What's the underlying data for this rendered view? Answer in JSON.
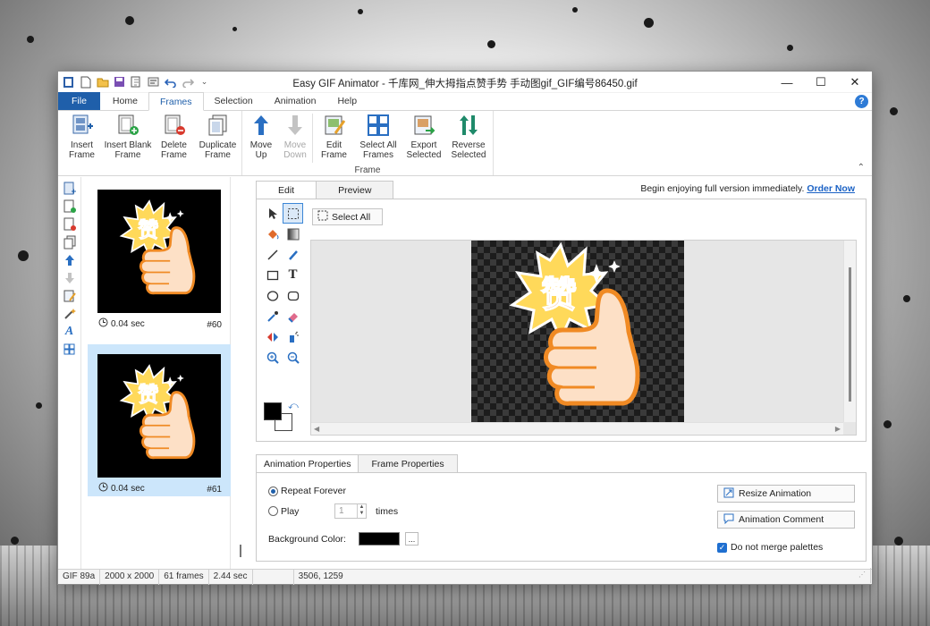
{
  "window": {
    "title": "Easy GIF Animator - 千库网_伸大拇指点赞手势 手动图gif_GIF编号86450.gif",
    "minimize": "—",
    "maximize": "☐",
    "close": "✕",
    "qat_dropdown": "⌄"
  },
  "ribbon": {
    "tabs": [
      "File",
      "Home",
      "Frames",
      "Selection",
      "Animation",
      "Help"
    ],
    "active_tab": "Frames",
    "help_icon": "?",
    "groups": [
      {
        "label": "",
        "buttons": [
          {
            "label": "Insert Frame",
            "line1": "Insert",
            "line2": "Frame",
            "icon": "insert-frame-icon"
          },
          {
            "label": "Insert Blank Frame",
            "line1": "Insert Blank",
            "line2": "Frame",
            "icon": "insert-blank-frame-icon"
          },
          {
            "label": "Delete Frame",
            "line1": "Delete",
            "line2": "Frame",
            "icon": "delete-frame-icon"
          },
          {
            "label": "Duplicate Frame",
            "line1": "Duplicate",
            "line2": "Frame",
            "icon": "duplicate-frame-icon"
          }
        ]
      },
      {
        "label": "Frame",
        "buttons": [
          {
            "label": "Move Up",
            "line1": "Move",
            "line2": "Up",
            "icon": "arrow-up-icon"
          },
          {
            "label": "Move Down",
            "line1": "Move",
            "line2": "Down",
            "icon": "arrow-down-icon",
            "disabled": true
          },
          {
            "label": "Edit Frame",
            "line1": "Edit",
            "line2": "Frame",
            "icon": "edit-frame-icon"
          },
          {
            "label": "Select All Frames",
            "line1": "Select All",
            "line2": "Frames",
            "icon": "select-all-frames-icon"
          },
          {
            "label": "Export Selected",
            "line1": "Export",
            "line2": "Selected",
            "icon": "export-selected-icon"
          },
          {
            "label": "Reverse Selected",
            "line1": "Reverse",
            "line2": "Selected",
            "icon": "reverse-selected-icon"
          }
        ]
      }
    ],
    "collapse": "⌃"
  },
  "frames": [
    {
      "time": "0.04 sec",
      "number": "#60",
      "selected": false
    },
    {
      "time": "0.04 sec",
      "number": "#61",
      "selected": true
    }
  ],
  "frame_graphic_text": "赞",
  "editor": {
    "tabs": [
      "Edit",
      "Preview"
    ],
    "active_tab": "Edit",
    "promo_text": "Begin enjoying full version immediately.",
    "promo_link": "Order Now",
    "select_all_button": "Select All",
    "scroll_left": "◀",
    "scroll_right": "▶"
  },
  "properties": {
    "tabs": [
      "Animation Properties",
      "Frame Properties"
    ],
    "active_tab": "Animation Properties",
    "repeat_forever": "Repeat Forever",
    "play": "Play",
    "play_times_value": "1",
    "times": "times",
    "background_color_label": "Background Color:",
    "background_color": "#000000",
    "dots_button": "...",
    "resize_button": "Resize Animation",
    "comment_button": "Animation Comment",
    "merge_checkbox": "Do not merge palettes",
    "merge_checked": true
  },
  "statusbar": {
    "format": "GIF 89a",
    "size": "2000 x 2000",
    "frames": "61 frames",
    "duration": "2.44 sec",
    "cursor": "3506,  1259"
  },
  "colors": {
    "accent": "#1f5faa",
    "selected_frame": "#cce6fb",
    "link": "#1b62c5",
    "burst_orange": "#f08a24",
    "burst_yellow": "#ffd95a",
    "thumb_skin": "#fde0c6"
  }
}
